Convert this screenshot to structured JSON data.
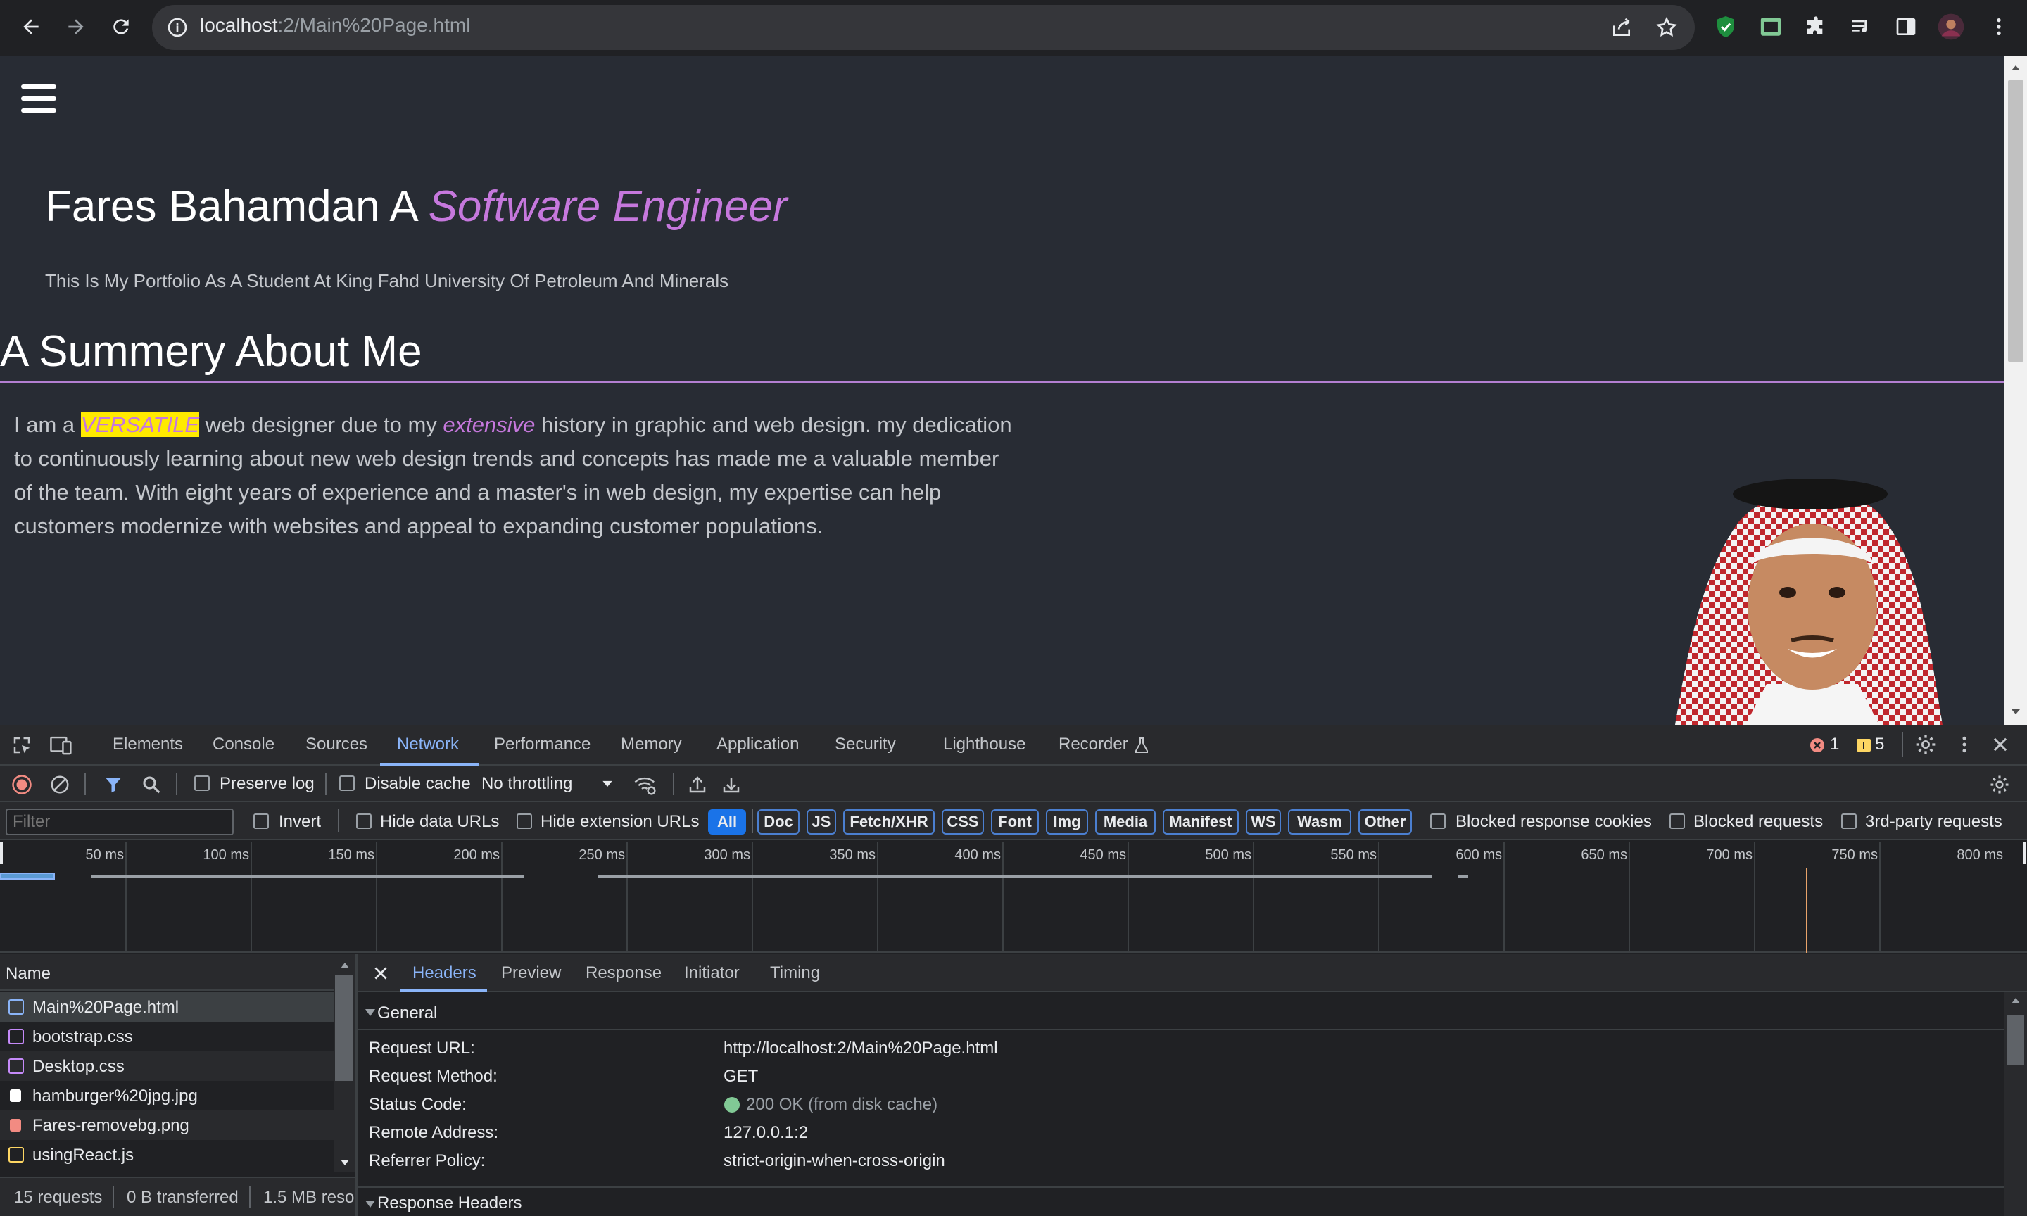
{
  "browser": {
    "url_host": "localhost",
    "url_path": ":2/Main%20Page.html"
  },
  "page": {
    "hero_title_plain": "Fares Bahamdan A ",
    "hero_title_em": "Software Engineer",
    "hero_subtitle": "This Is My Portfolio As A Student At King Fahd University Of Petroleum And Minerals",
    "about_heading": "A Summery About Me",
    "about_p1": "I am a ",
    "about_highlight": "VERSATILE",
    "about_p2": " web designer due to my ",
    "about_em": "extensive",
    "about_p3": " history in graphic and web design. my dedication to continuously learning about new web design trends and concepts has made me a valuable member of the team. With eight years of experience and a master's in web design, my expertise can help customers modernize with websites and appeal to expanding customer populations."
  },
  "devtools": {
    "tabs": [
      "Elements",
      "Console",
      "Sources",
      "Network",
      "Performance",
      "Memory",
      "Application",
      "Security",
      "Lighthouse",
      "Recorder"
    ],
    "active_tab": "Network",
    "error_count": "1",
    "warning_count": "5",
    "toolbar": {
      "preserve_log": "Preserve log",
      "disable_cache": "Disable cache",
      "throttling": "No throttling"
    },
    "filter_bar": {
      "filter_placeholder": "Filter",
      "invert": "Invert",
      "hide_data_urls": "Hide data URLs",
      "hide_extension_urls": "Hide extension URLs",
      "type_filters": [
        "All",
        "Doc",
        "JS",
        "Fetch/XHR",
        "CSS",
        "Font",
        "Img",
        "Media",
        "Manifest",
        "WS",
        "Wasm",
        "Other"
      ],
      "blocked_response_cookies": "Blocked response cookies",
      "blocked_requests": "Blocked requests",
      "third_party_requests": "3rd-party requests"
    },
    "timeline_ticks": [
      "50 ms",
      "100 ms",
      "150 ms",
      "200 ms",
      "250 ms",
      "300 ms",
      "350 ms",
      "400 ms",
      "450 ms",
      "500 ms",
      "550 ms",
      "600 ms",
      "650 ms",
      "700 ms",
      "750 ms",
      "800 ms"
    ],
    "name_header": "Name",
    "requests": [
      {
        "name": "Main%20Page.html",
        "icon": "document-icon",
        "color": "#8ab4f8"
      },
      {
        "name": "bootstrap.css",
        "icon": "stylesheet-icon",
        "color": "#c58af9"
      },
      {
        "name": "Desktop.css",
        "icon": "stylesheet-icon",
        "color": "#c58af9"
      },
      {
        "name": "hamburger%20jpg.jpg",
        "icon": "file-icon",
        "color": "#ffffff"
      },
      {
        "name": "Fares-removebg.png",
        "icon": "image-icon",
        "color": "#f28b82"
      },
      {
        "name": "usingReact.js",
        "icon": "script-icon",
        "color": "#fdd663"
      }
    ],
    "status_bar": {
      "requests": "15 requests",
      "transferred": "0 B transferred",
      "resources": "1.5 MB resou"
    },
    "detail_tabs": [
      "Headers",
      "Preview",
      "Response",
      "Initiator",
      "Timing"
    ],
    "general_heading": "General",
    "general": [
      {
        "key": "Request URL:",
        "value": "http://localhost:2/Main%20Page.html"
      },
      {
        "key": "Request Method:",
        "value": "GET"
      },
      {
        "key": "Status Code:",
        "value": "200 OK (from disk cache)"
      },
      {
        "key": "Remote Address:",
        "value": "127.0.0.1:2"
      },
      {
        "key": "Referrer Policy:",
        "value": "strict-origin-when-cross-origin"
      }
    ],
    "response_headers_heading": "Response Headers",
    "colors": {
      "accent": "#8ab4f8",
      "status_ok": "#81c995",
      "error": "#f28b82",
      "warning": "#fdd663"
    }
  }
}
